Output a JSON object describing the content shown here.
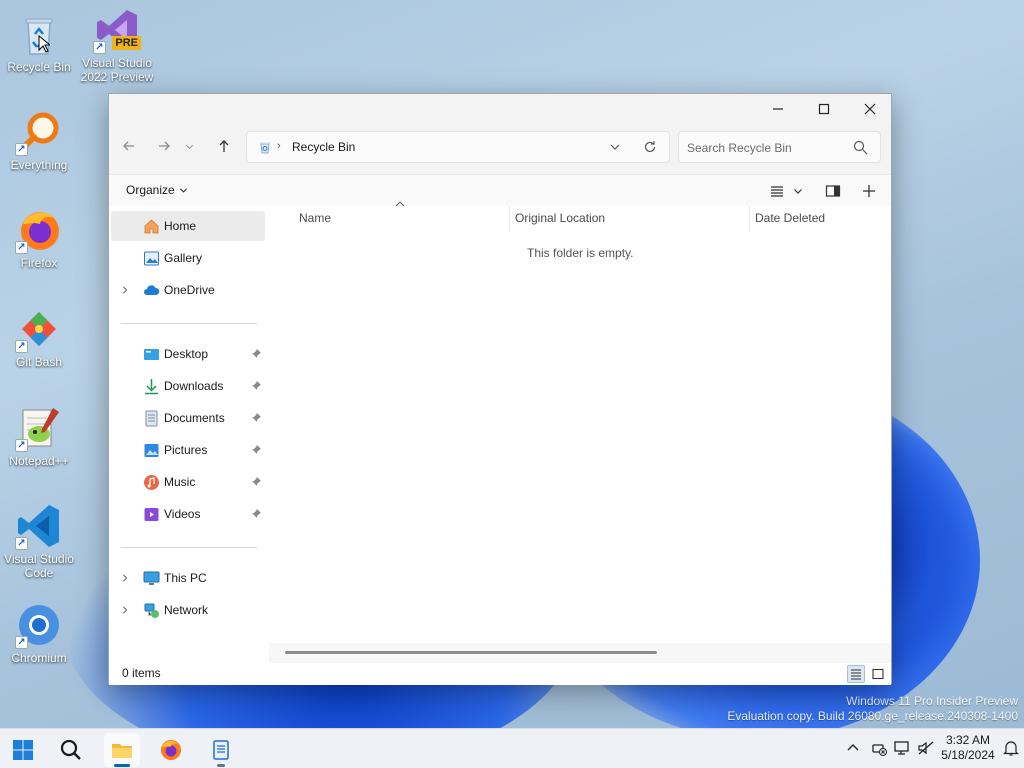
{
  "desktop": {
    "icons": [
      {
        "label": "Recycle Bin"
      },
      {
        "label": "Visual Studio 2022 Preview",
        "badge": "PRE"
      },
      {
        "label": "Everything"
      },
      {
        "label": "Firefox"
      },
      {
        "label": "Git Bash"
      },
      {
        "label": "Notepad++"
      },
      {
        "label": "Visual Studio Code"
      },
      {
        "label": "Chromium"
      }
    ],
    "watermark_line1": "Windows 11 Pro Insider Preview",
    "watermark_line2": "Evaluation copy. Build 26080.ge_release.240308-1400"
  },
  "explorer": {
    "address_crumb": "Recycle Bin",
    "search_placeholder": "Search Recycle Bin",
    "organize_label": "Organize",
    "nav": {
      "home": "Home",
      "gallery": "Gallery",
      "onedrive": "OneDrive",
      "desktop": "Desktop",
      "downloads": "Downloads",
      "documents": "Documents",
      "pictures": "Pictures",
      "music": "Music",
      "videos": "Videos",
      "this_pc": "This PC",
      "network": "Network"
    },
    "columns": {
      "name": "Name",
      "original_location": "Original Location",
      "date_deleted": "Date Deleted"
    },
    "empty_message": "This folder is empty.",
    "status_count": "0 items"
  },
  "taskbar": {
    "time": "3:32 AM",
    "date": "5/18/2024"
  },
  "colors": {
    "accent": "#0067c0",
    "window_bg": "#f3f3f3",
    "selection": "#ebebeb"
  }
}
